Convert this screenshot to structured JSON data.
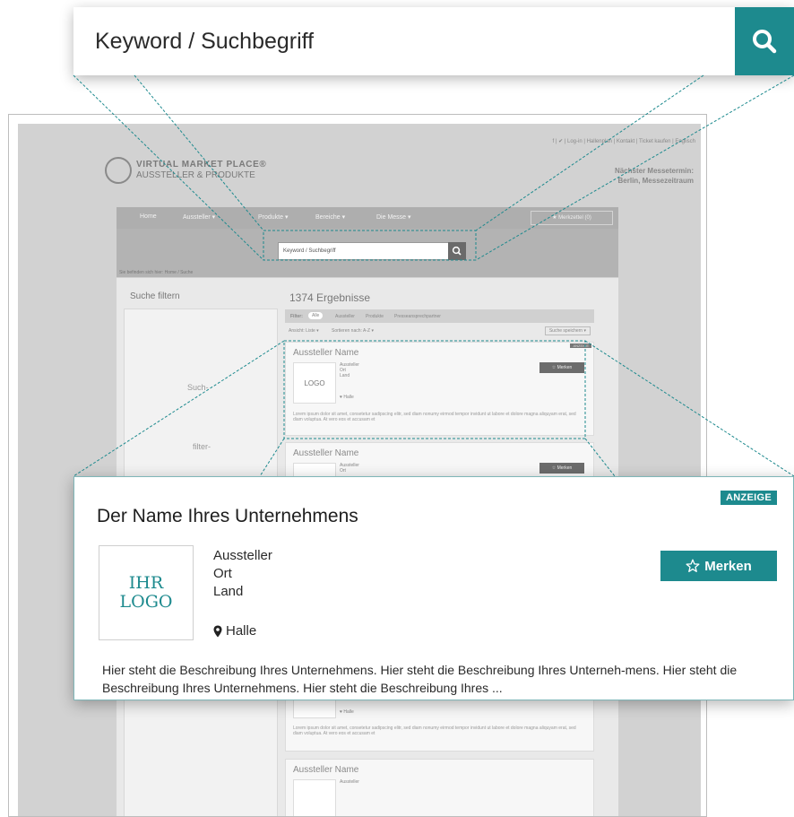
{
  "search": {
    "placeholder": "Keyword / Suchbegriff",
    "icon": "search-icon",
    "accent_color": "#1d8a8e"
  },
  "background_page": {
    "utility_links": "f | ✔ | Log-in | Hallenplan | Kontakt | Ticket kaufen | Englisch",
    "brand": {
      "line1": "VIRTUAL MARKET PLACE®",
      "line2": "AUSSTELLER & PRODUKTE"
    },
    "next_fair": {
      "line1": "Nächster Messetermin:",
      "line2": "Berlin, Messezeitraum"
    },
    "nav": [
      "Home",
      "Aussteller ▾",
      "Produkte ▾",
      "Bereiche ▾",
      "Die Messe ▾"
    ],
    "watchlist": "★ Merkzettel (0)",
    "search_placeholder": "Keyword / Suchbegriff",
    "breadcrumb": "Sie befinden sich hier: Home / Suche",
    "sidebar": {
      "title": "Suche filtern",
      "text1": "Such-",
      "text2": "filter-"
    },
    "results": {
      "title": "1374 Ergebnisse",
      "filter_label": "Filter:",
      "filter_tabs": [
        "Alle",
        "Aussteller",
        "Produkte",
        "Presseansprechpartner"
      ],
      "view_label": "Ansicht: Liste ▾",
      "sort_label": "Sortieren nach: A-Z ▾",
      "save_search": "Suche speichern ▾"
    },
    "mini_cards": [
      {
        "title": "Aussteller Name",
        "badge": "ANZEIGE",
        "logo": "LOGO",
        "info": [
          "Aussteller",
          "Ort",
          "Land"
        ],
        "halle": "♥ Halle",
        "button": "☆ Merken",
        "desc": "Lorem ipsum dolor sit amet, consetetur sadipscing elitr, sed diam nonumy eirmod tempor invidunt ut labore et dolore magna aliquyam erat, sed diam voluptua. At vero eos et accusam et"
      },
      {
        "title": "Aussteller Name",
        "info": [
          "Aussteller",
          "Ort"
        ],
        "button": "☆ Merken"
      },
      {
        "halle": "♥ Halle",
        "desc": "Lorem ipsum dolor sit amet, consetetur sadipscing elitr, sed diam nonumy eirmod tempor invidunt ut labore et dolore magna aliquyam erat, sed diam voluptua. At vero eos et accusam et"
      },
      {
        "title": "Aussteller Name",
        "info": [
          "Aussteller"
        ]
      }
    ]
  },
  "ad_card": {
    "company_name": "Der Name Ihres Unternehmens",
    "badge": "ANZEIGE",
    "logo_line1": "IHR",
    "logo_line2": "LOGO",
    "info": [
      "Aussteller",
      "Ort",
      "Land"
    ],
    "halle": "Halle",
    "merken_label": "Merken",
    "description": "Hier steht die Beschreibung Ihres Unternehmens. Hier steht die Beschreibung Ihres Unterneh-mens. Hier steht die Beschreibung Ihres Unternehmens. Hier steht die Beschreibung Ihres ..."
  }
}
